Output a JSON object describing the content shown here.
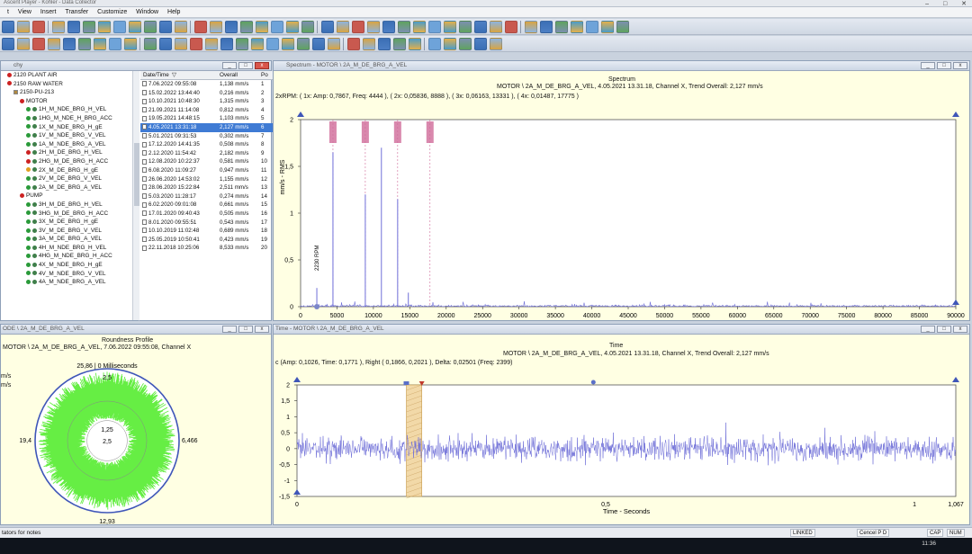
{
  "app": {
    "title": "Ascent Player - Kohler - Data Collector"
  },
  "menu": [
    "t",
    "View",
    "Insert",
    "Transfer",
    "Customize",
    "Window",
    "Help"
  ],
  "hierarchy": {
    "title": "chy",
    "tree": [
      {
        "label": "2120 PLANT AIR",
        "indent": 1,
        "kind": "node",
        "color": "#cc2222"
      },
      {
        "label": "2150 RAW WATER",
        "indent": 1,
        "kind": "node",
        "color": "#cc2222"
      },
      {
        "label": "2150-PU-213",
        "indent": 2,
        "kind": "folder",
        "color": "#b08a40"
      },
      {
        "label": "MOTOR",
        "indent": 3,
        "kind": "node",
        "color": "#cc2222"
      },
      {
        "label": "1H_M_NDE_BRG_H_VEL",
        "indent": 4,
        "kind": "meas",
        "color": "#2a9a3a"
      },
      {
        "label": "1HG_M_NDE_H_BRG_ACC",
        "indent": 4,
        "kind": "meas",
        "color": "#2a9a3a"
      },
      {
        "label": "1X_M_NDE_BRG_H_gE",
        "indent": 4,
        "kind": "meas",
        "color": "#2a9a3a"
      },
      {
        "label": "1V_M_NDE_BRG_V_VEL",
        "indent": 4,
        "kind": "meas",
        "color": "#2a9a3a"
      },
      {
        "label": "1A_M_NDE_BRG_A_VEL",
        "indent": 4,
        "kind": "meas",
        "color": "#2a9a3a"
      },
      {
        "label": "2H_M_DE_BRG_H_VEL",
        "indent": 4,
        "kind": "meas",
        "color": "#cc2222"
      },
      {
        "label": "2HG_M_DE_BRG_H_ACC",
        "indent": 4,
        "kind": "meas",
        "color": "#cc2222"
      },
      {
        "label": "2X_M_DE_BRG_H_gE",
        "indent": 4,
        "kind": "meas",
        "color": "#e0a020"
      },
      {
        "label": "2V_M_DE_BRG_V_VEL",
        "indent": 4,
        "kind": "meas",
        "color": "#2a9a3a"
      },
      {
        "label": "2A_M_DE_BRG_A_VEL",
        "indent": 4,
        "kind": "meas",
        "color": "#2a9a3a"
      },
      {
        "label": "PUMP",
        "indent": 3,
        "kind": "node",
        "color": "#cc2222"
      },
      {
        "label": "3H_M_DE_BRG_H_VEL",
        "indent": 4,
        "kind": "meas",
        "color": "#2a9a3a"
      },
      {
        "label": "3HG_M_DE_BRG_H_ACC",
        "indent": 4,
        "kind": "meas",
        "color": "#2a9a3a"
      },
      {
        "label": "3X_M_DE_BRG_H_gE",
        "indent": 4,
        "kind": "meas",
        "color": "#2a9a3a"
      },
      {
        "label": "3V_M_DE_BRG_V_VEL",
        "indent": 4,
        "kind": "meas",
        "color": "#2a9a3a"
      },
      {
        "label": "3A_M_DE_BRG_A_VEL",
        "indent": 4,
        "kind": "meas",
        "color": "#2a9a3a"
      },
      {
        "label": "4H_M_NDE_BRG_H_VEL",
        "indent": 4,
        "kind": "meas",
        "color": "#2a9a3a"
      },
      {
        "label": "4HG_M_NDE_BRG_H_ACC",
        "indent": 4,
        "kind": "meas",
        "color": "#2a9a3a"
      },
      {
        "label": "4X_M_NDE_BRG_H_gE",
        "indent": 4,
        "kind": "meas",
        "color": "#2a9a3a"
      },
      {
        "label": "4V_M_NDE_BRG_V_VEL",
        "indent": 4,
        "kind": "meas",
        "color": "#2a9a3a"
      },
      {
        "label": "4A_M_NDE_BRG_A_VEL",
        "indent": 4,
        "kind": "meas",
        "color": "#2a9a3a"
      }
    ],
    "columns": [
      "Date/Time",
      "Overall",
      "Po"
    ],
    "rows": [
      [
        "7.06.2022 09:55:08",
        "1,138 mm/s",
        "1"
      ],
      [
        "15.02.2022 13:44:40",
        "0,216 mm/s",
        "2"
      ],
      [
        "10.10.2021 10:48:30",
        "1,315 mm/s",
        "3"
      ],
      [
        "21.09.2021 11:14:08",
        "0,812 mm/s",
        "4"
      ],
      [
        "19.05.2021 14:48:15",
        "1,103 mm/s",
        "5"
      ],
      [
        "4.05.2021 13:31:18",
        "2,127 mm/s",
        "6"
      ],
      [
        "5.01.2021 09:31:53",
        "0,302 mm/s",
        "7"
      ],
      [
        "17.12.2020 14:41:35",
        "0,508 mm/s",
        "8"
      ],
      [
        "2.12.2020 11:54:42",
        "2,182 mm/s",
        "9"
      ],
      [
        "12.08.2020 10:22:37",
        "0,581 mm/s",
        "10"
      ],
      [
        "6.08.2020 11:09:27",
        "0,947 mm/s",
        "11"
      ],
      [
        "26.06.2020 14:53:02",
        "1,155 mm/s",
        "12"
      ],
      [
        "28.06.2020 15:22:84",
        "2,511 mm/s",
        "13"
      ],
      [
        "5.03.2020 11:28:17",
        "0,274 mm/s",
        "14"
      ],
      [
        "6.02.2020 09:01:08",
        "0,661 mm/s",
        "15"
      ],
      [
        "17.01.2020 09:40:43",
        "0,505 mm/s",
        "16"
      ],
      [
        "8.01.2020 09:55:51",
        "0,543 mm/s",
        "17"
      ],
      [
        "10.10.2019 11:02:48",
        "0,689 mm/s",
        "18"
      ],
      [
        "25.05.2019 10:50:41",
        "0,423 mm/s",
        "19"
      ],
      [
        "22.11.2018 10:25:06",
        "8,533 mm/s",
        "20"
      ]
    ],
    "selected_index": 5
  },
  "spectrum": {
    "window_title": "Spectrum - MOTOR \\ 2A_M_DE_BRG_A_VEL",
    "title": "Spectrum",
    "subtitle": "MOTOR \\ 2A_M_DE_BRG_A_VEL, 4.05.2021 13.31.18, Channel X, Trend Overall: 2,127 mm/s",
    "cursor_info": "2xRPM:  ( 1x:  Amp: 0,7867, Freq: 4444 ),  ( 2x:  0,05836, 8888 ),  ( 3x:  0,06163, 13331 ),  ( 4x:  0,01487, 17775 )",
    "marker_label": "2230 RPM",
    "harmonic_marks": [
      4444,
      8888,
      13331,
      17775
    ]
  },
  "time_wave": {
    "window_title": "Time - MOTOR \\ 2A_M_DE_BRG_A_VEL",
    "title": "Time",
    "subtitle": "MOTOR \\ 2A_M_DE_BRG_A_VEL, 4.05.2021 13.31.18, Channel X, Trend Overall: 2,127 mm/s",
    "cursor_info": "c (Amp:  0,1026, Time:  0,1771 ),  Right (  0,1866,  0,2021 ),  Delta:  0,02501 (Freq: 2399)"
  },
  "roundness": {
    "window_title": "ODE \\ 2A_M_DE_BRG_A_VEL",
    "title": "Roundness Profile",
    "subtitle": "MOTOR \\ 2A_M_DE_BRG_A_VEL, 7.06.2022 09:55:08, Channel X",
    "unit1": "m/s",
    "unit2": "m/s",
    "top_label": "25,86 | 0 Milliseconds",
    "left_label": "19,4",
    "right_label": "6,466",
    "bottom_label": "12,93",
    "ring_outer": "2,5",
    "ring_inner": "1,25",
    "center": "2,5",
    "footer": "Trend"
  },
  "chart_data": [
    {
      "type": "line",
      "title": "Spectrum",
      "xlabel": "Frequency - CPM",
      "ylabel": "mm/s - RMS",
      "xlim": [
        0,
        90000
      ],
      "ylim": [
        0,
        2
      ],
      "x_ticks": [
        "0",
        "5000",
        "10000",
        "15000",
        "20000",
        "25000",
        "30000",
        "35000",
        "40000",
        "45000",
        "50000",
        "55000",
        "60000",
        "65000",
        "70000",
        "75000",
        "80000",
        "85000",
        "90000"
      ],
      "y_ticks": [
        "0",
        "0,5",
        "1",
        "1,5",
        "2"
      ],
      "peaks": [
        {
          "x": 2230,
          "y": 0.2
        },
        {
          "x": 4444,
          "y": 1.65
        },
        {
          "x": 8888,
          "y": 1.2
        },
        {
          "x": 11100,
          "y": 1.7
        },
        {
          "x": 13331,
          "y": 1.15
        },
        {
          "x": 14800,
          "y": 0.15
        }
      ]
    },
    {
      "type": "line",
      "title": "Time",
      "xlabel": "Time - Seconds",
      "xlim": [
        0,
        1.067
      ],
      "ylim": [
        -1.5,
        2
      ],
      "x_ticks": [
        "0",
        "0,5",
        "1",
        "1,067"
      ],
      "y_ticks": [
        "2",
        "1,5",
        "1",
        "0,5",
        "0",
        "-0,5",
        "-1",
        "-1,5"
      ],
      "cursor_band": [
        0.1771,
        0.2021
      ],
      "amplitude_rms": 0.3
    }
  ],
  "status": {
    "left": "tators for notes",
    "indicators": [
      "LINKED",
      "Cencel P D",
      "CAP",
      "NUM"
    ],
    "clock": "11:36"
  },
  "colors": {
    "panel_bg": "#ffffe3",
    "signal": "#6f6fd8",
    "roundness": "#66ee44",
    "harmonic": "#d06a98",
    "selection": "#3f7bd4"
  }
}
